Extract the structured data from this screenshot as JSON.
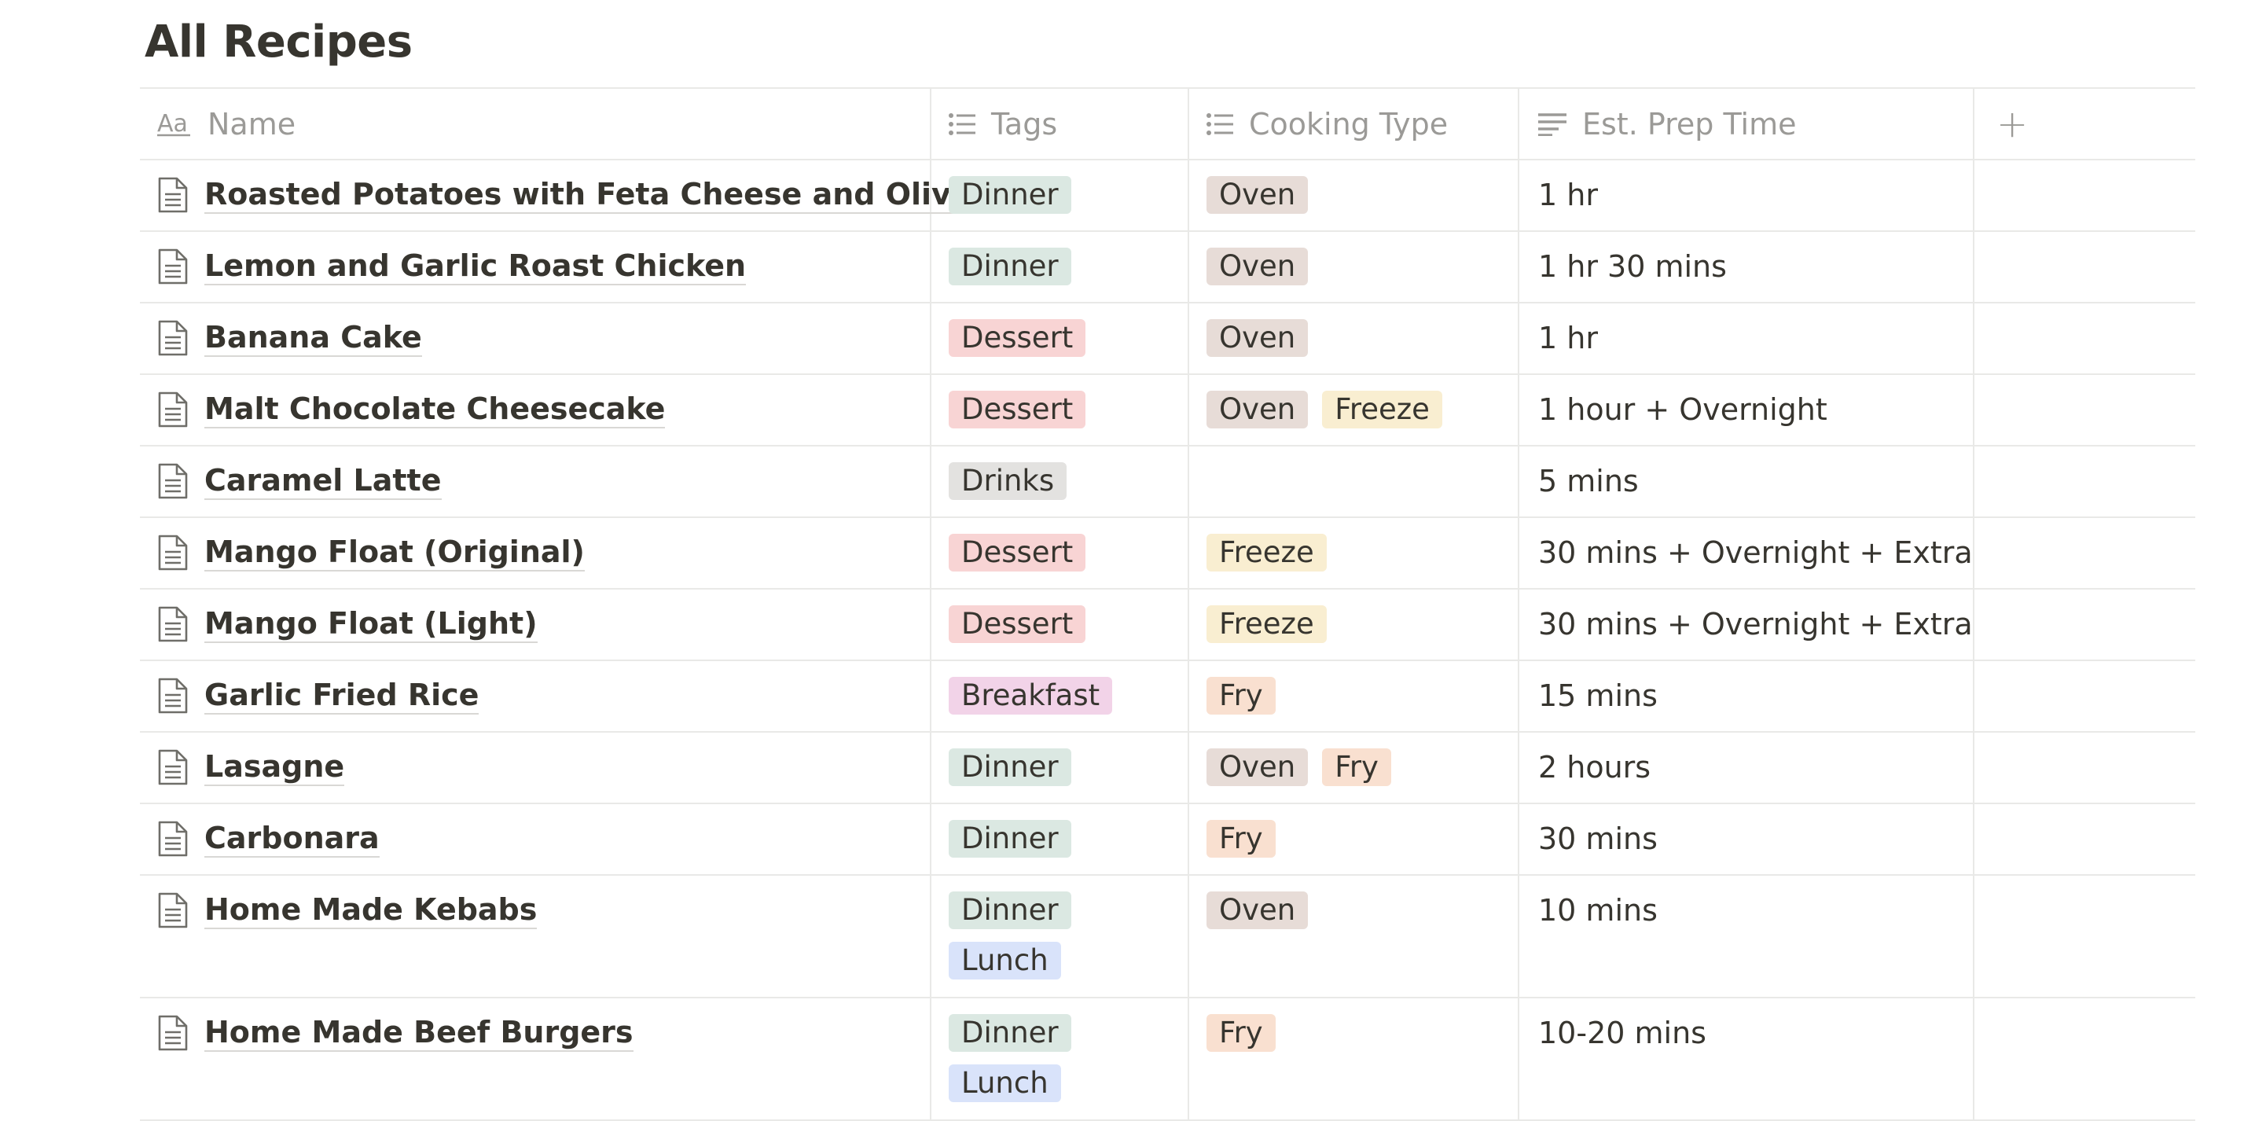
{
  "page": {
    "title": "All Recipes"
  },
  "columns": {
    "name": "Name",
    "tags": "Tags",
    "cooking_type": "Cooking Type",
    "prep_time": "Est. Prep Time",
    "add": "+"
  },
  "tag_colors": {
    "Dinner": "#dbe8e2",
    "Dessert": "#f8d4d4",
    "Drinks": "#e3e2e0",
    "Breakfast": "#f2d3e8",
    "Lunch": "#d9e3fa",
    "Oven": "#e7dcd7",
    "Freeze": "#f9eed1",
    "Fry": "#f9e0d0"
  },
  "rows": [
    {
      "name": "Roasted Potatoes with Feta Cheese and Olives",
      "tags": [
        "Dinner"
      ],
      "cooking": [
        "Oven"
      ],
      "prep": "1 hr"
    },
    {
      "name": "Lemon and Garlic Roast Chicken",
      "tags": [
        "Dinner"
      ],
      "cooking": [
        "Oven"
      ],
      "prep": "1 hr 30 mins"
    },
    {
      "name": "Banana Cake",
      "tags": [
        "Dessert"
      ],
      "cooking": [
        "Oven"
      ],
      "prep": "1 hr"
    },
    {
      "name": "Malt Chocolate Cheesecake",
      "tags": [
        "Dessert"
      ],
      "cooking": [
        "Oven",
        "Freeze"
      ],
      "prep": "1 hour + Overnight"
    },
    {
      "name": "Caramel Latte",
      "tags": [
        "Drinks"
      ],
      "cooking": [],
      "prep": "5 mins"
    },
    {
      "name": "Mango Float (Original)",
      "tags": [
        "Dessert"
      ],
      "cooking": [
        "Freeze"
      ],
      "prep": "30 mins + Overnight + Extra"
    },
    {
      "name": "Mango Float (Light)",
      "tags": [
        "Dessert"
      ],
      "cooking": [
        "Freeze"
      ],
      "prep": "30 mins + Overnight + Extra"
    },
    {
      "name": "Garlic Fried Rice",
      "tags": [
        "Breakfast"
      ],
      "cooking": [
        "Fry"
      ],
      "prep": "15 mins"
    },
    {
      "name": "Lasagne",
      "tags": [
        "Dinner"
      ],
      "cooking": [
        "Oven",
        "Fry"
      ],
      "prep": "2 hours"
    },
    {
      "name": "Carbonara",
      "tags": [
        "Dinner"
      ],
      "cooking": [
        "Fry"
      ],
      "prep": "30 mins"
    },
    {
      "name": "Home Made Kebabs",
      "tags": [
        "Dinner",
        "Lunch"
      ],
      "cooking": [
        "Oven"
      ],
      "prep": "10 mins"
    },
    {
      "name": "Home Made Beef Burgers",
      "tags": [
        "Dinner",
        "Lunch"
      ],
      "cooking": [
        "Fry"
      ],
      "prep": "10-20 mins"
    }
  ]
}
